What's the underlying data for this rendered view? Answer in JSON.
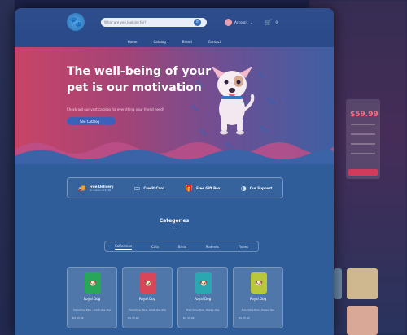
{
  "header": {
    "search_placeholder": "What are you looking for?",
    "account_label": "Account",
    "cart_count": "0"
  },
  "nav": [
    "Home",
    "Catalog",
    "Brand",
    "Contact"
  ],
  "hero": {
    "title": "The well-being of your pet is our motivation",
    "subtitle": "Check out our vast catalog for everything your friend need!",
    "cta": "See Catalog"
  },
  "features": [
    {
      "title": "Free Delivery",
      "sub": "on orders of $100",
      "icon": "truck-icon"
    },
    {
      "title": "Credit Card",
      "sub": "",
      "icon": "credit-card-icon"
    },
    {
      "title": "Free Gift Box",
      "sub": "",
      "icon": "gift-icon"
    },
    {
      "title": "Our Support",
      "sub": "",
      "icon": "support-icon"
    }
  ],
  "categories": {
    "title": "Categories",
    "tabs": [
      "Cat/canine",
      "Cats",
      "Birds",
      "Rodents",
      "Fishes"
    ]
  },
  "products": [
    {
      "name": "Royal Dog",
      "desc": "Frenching Plus - Adult dog 2kg",
      "price": "R$ 35.99",
      "bag_color": "#2aa65a"
    },
    {
      "name": "Royal Dog",
      "desc": "Frenching Plus - Adult dog 2kg",
      "price": "R$ 35.99",
      "bag_color": "#d8465a"
    },
    {
      "name": "Royal Dog",
      "desc": "Frenching Plus - Puppy dog",
      "price": "R$ 35.99",
      "bag_color": "#2aa7b0"
    },
    {
      "name": "Royal Dog",
      "desc": "Frenching Plus - Puppy dog",
      "price": "R$ 35.99",
      "bag_color": "#b8c83a"
    }
  ],
  "background_page": {
    "price": "$59.99"
  }
}
